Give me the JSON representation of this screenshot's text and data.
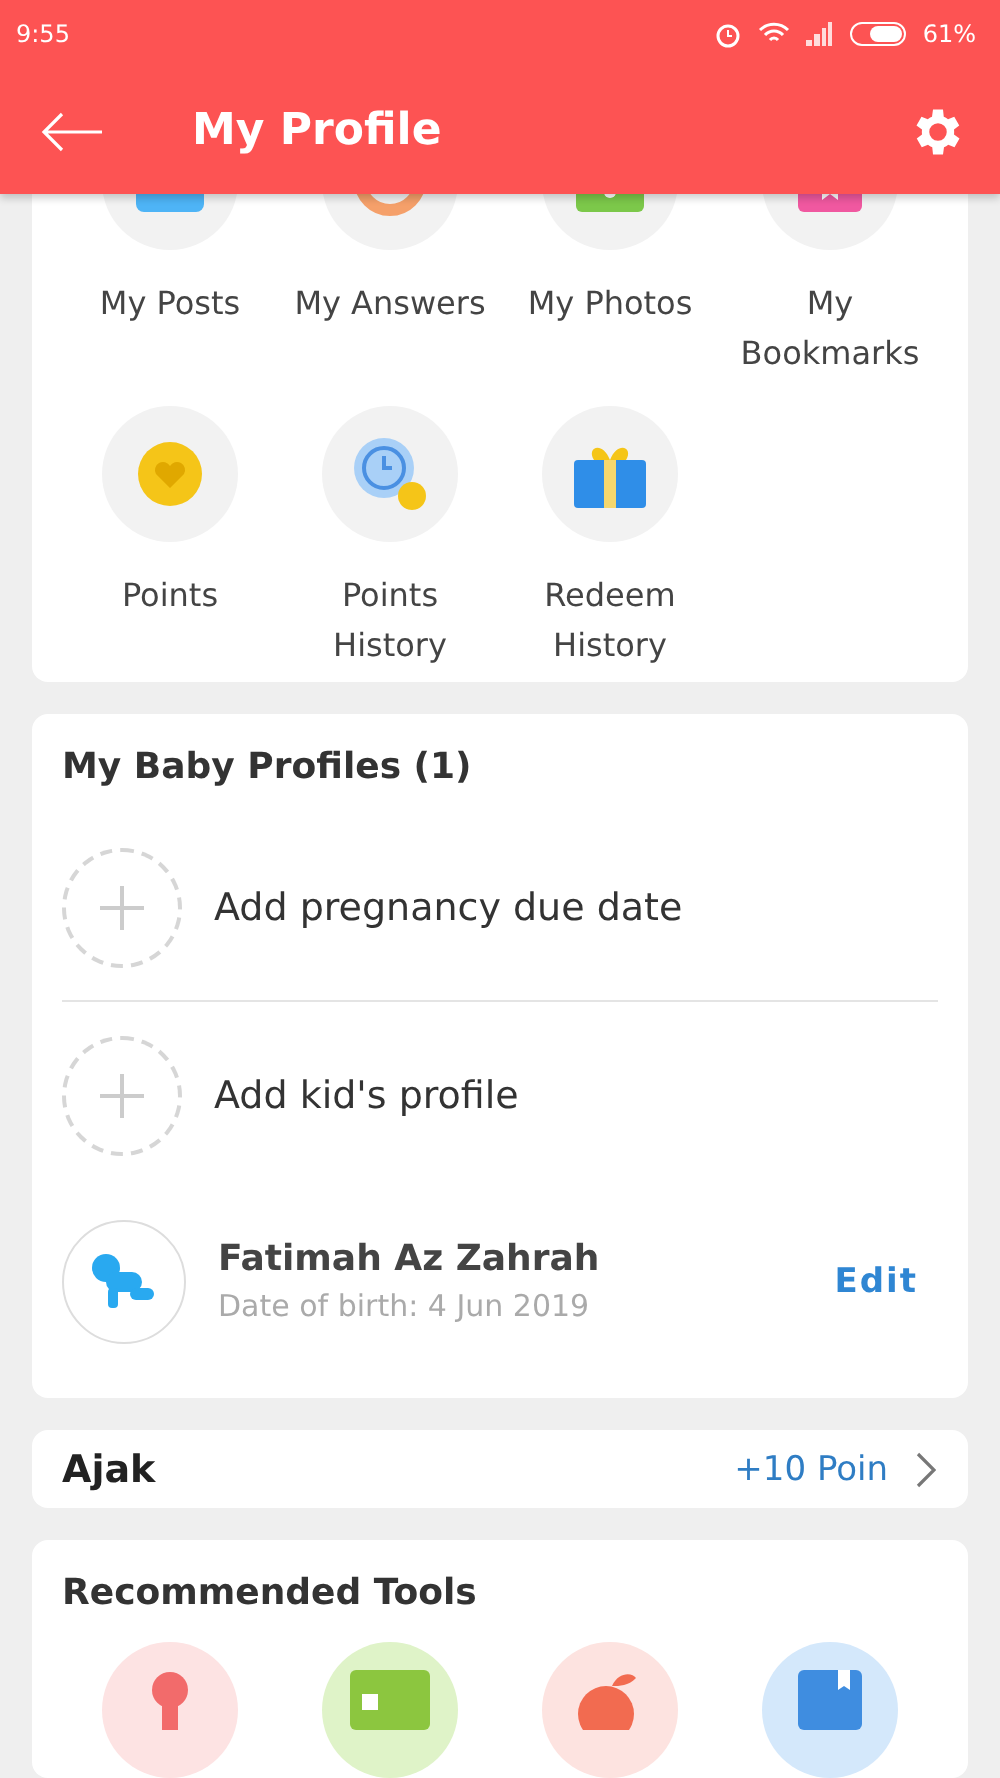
{
  "status_bar": {
    "time": "9:55",
    "battery": "61%"
  },
  "header": {
    "title": "My Profile"
  },
  "shortcuts": [
    {
      "label": "My Posts"
    },
    {
      "label": "My Answers"
    },
    {
      "label": "My Photos"
    },
    {
      "label": "My Bookmarks"
    },
    {
      "label": "Points"
    },
    {
      "label": "Points History"
    },
    {
      "label": "Redeem History"
    }
  ],
  "baby_profiles": {
    "title": "My Baby Profiles (1)",
    "add_rows": [
      {
        "label": "Add pregnancy due date"
      },
      {
        "label": "Add kid's profile"
      }
    ],
    "profiles": [
      {
        "name": "Fatimah Az Zahrah",
        "dob": "Date of birth: 4 Jun 2019",
        "action": "Edit"
      }
    ]
  },
  "invite": {
    "label": "Ajak",
    "reward": "+10 Poin"
  },
  "tools": {
    "title": "Recommended Tools"
  }
}
